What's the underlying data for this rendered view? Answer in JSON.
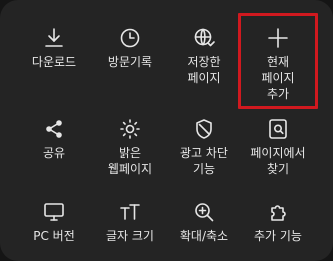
{
  "menu": {
    "items": [
      {
        "label": "다운로드",
        "icon": "download-icon"
      },
      {
        "label": "방문기록",
        "icon": "clock-icon"
      },
      {
        "label_line1": "저장한",
        "label_line2": "페이지",
        "icon": "globe-save-icon"
      },
      {
        "label_line1": "현재",
        "label_line2": "페이지",
        "label_line3": "추가",
        "icon": "plus-icon"
      },
      {
        "label": "공유",
        "icon": "share-icon"
      },
      {
        "label_line1": "밝은",
        "label_line2": "웹페이지",
        "icon": "sun-icon"
      },
      {
        "label_line1": "광고 차단",
        "label_line2": "기능",
        "icon": "shield-icon"
      },
      {
        "label_line1": "페이지에서",
        "label_line2": "찾기",
        "icon": "find-in-page-icon"
      },
      {
        "label": "PC 버전",
        "icon": "desktop-icon"
      },
      {
        "label": "글자 크기",
        "icon": "text-size-icon"
      },
      {
        "label": "확대/축소",
        "icon": "zoom-icon"
      },
      {
        "label": "추가 기능",
        "icon": "puzzle-icon"
      }
    ]
  },
  "highlight_color": "#d0191f"
}
